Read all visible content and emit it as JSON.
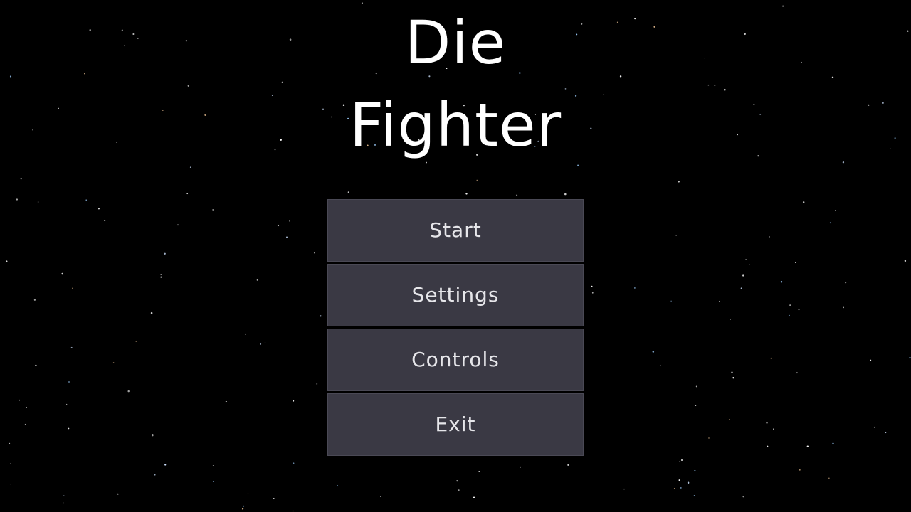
{
  "game": {
    "title_line_1": "Die",
    "title_line_2": "Fighter"
  },
  "main_menu": {
    "items": [
      {
        "label": "Start"
      },
      {
        "label": "Settings"
      },
      {
        "label": "Controls"
      },
      {
        "label": "Exit"
      }
    ]
  },
  "colors": {
    "background": "#000000",
    "title_text": "#ffffff",
    "button_fill": "#3a3944",
    "button_text": "#e6e6ea"
  }
}
